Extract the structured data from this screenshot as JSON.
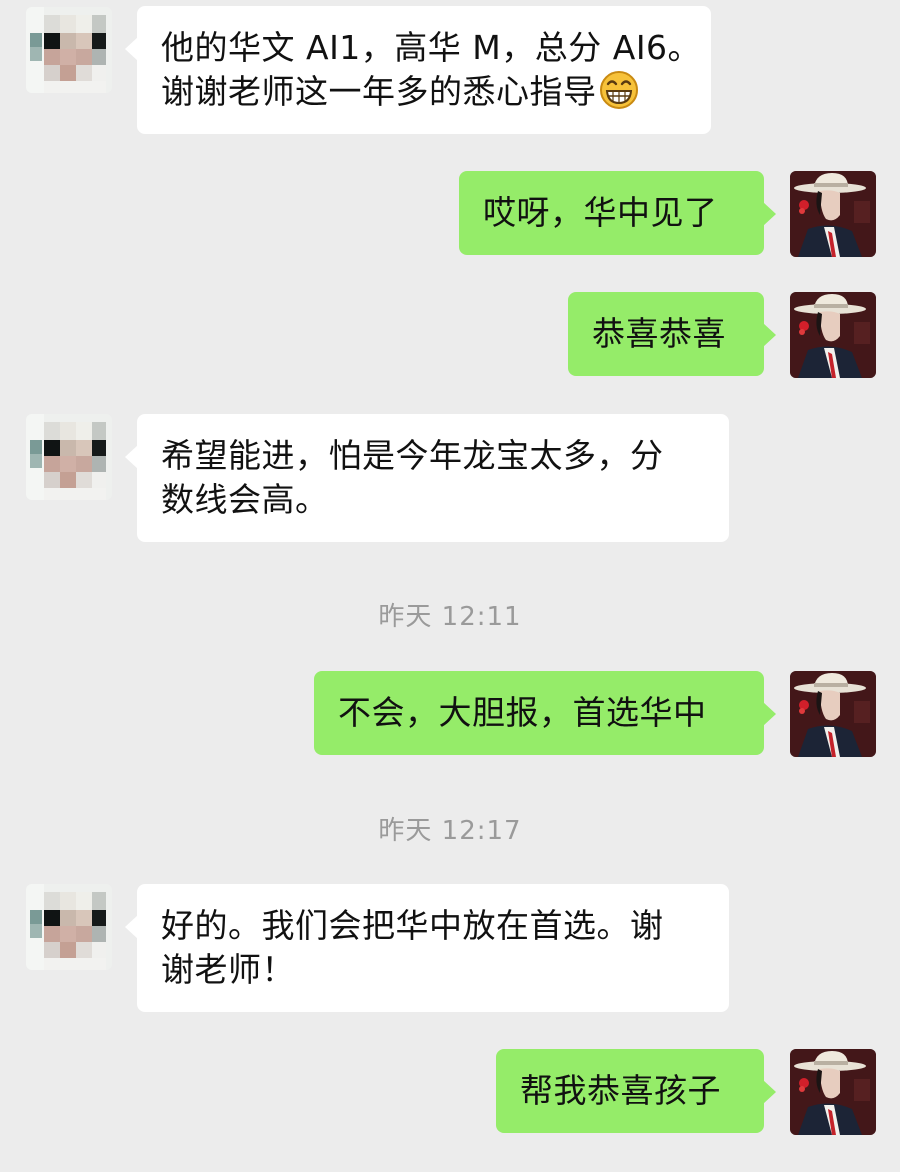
{
  "chat": {
    "messages": [
      {
        "from": "other",
        "lines": [
          "他的华文 AI1，高华 M，总分 AI6。",
          "谢谢老师这一年多的悉心指导"
        ],
        "emoji": "grinning-face-emoji"
      },
      {
        "from": "me",
        "lines": [
          "哎呀，华中见了"
        ]
      },
      {
        "from": "me",
        "lines": [
          "恭喜恭喜"
        ]
      },
      {
        "from": "other",
        "lines": [
          "希望能进，怕是今年龙宝太多，分",
          "数线会高。"
        ]
      },
      {
        "from": "me",
        "lines": [
          "不会，大胆报，首选华中"
        ]
      },
      {
        "from": "other",
        "lines": [
          "好的。我们会把华中放在首选。谢",
          "谢老师！"
        ]
      },
      {
        "from": "me",
        "lines": [
          "帮我恭喜孩子"
        ]
      }
    ],
    "timestamps": [
      "昨天 12:11",
      "昨天 12:17"
    ]
  },
  "colors": {
    "background": "#ececec",
    "incoming_bubble": "#ffffff",
    "outgoing_bubble": "#95ec69",
    "timestamp_text": "#9a9a9a"
  },
  "icons": {
    "contact_avatar": "pixelated-avatar",
    "my_avatar": "woman-in-hat-avatar",
    "emoji": "grinning-face-emoji"
  }
}
